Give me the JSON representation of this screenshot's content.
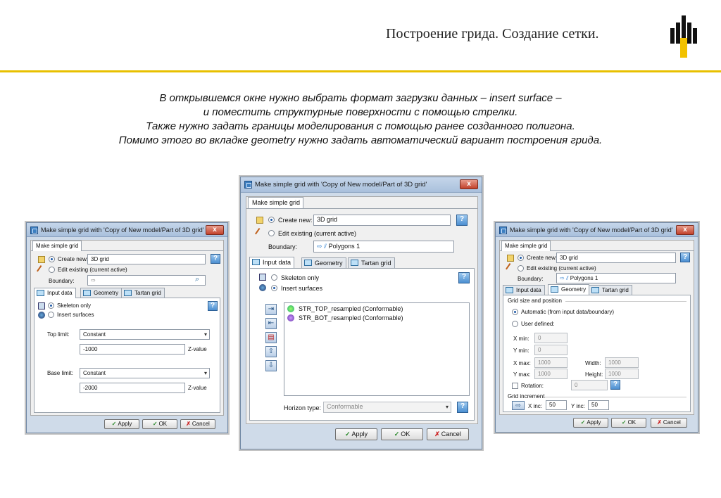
{
  "slide": {
    "title": "Построение грида. Создание сетки.",
    "intro": [
      "В открывшемся окне нужно выбрать формат загрузки данных – insert surface –",
      "и поместить структурные поверхности с помощью стрелки.",
      "Также нужно задать границы моделирования с помощью ранее созданного полигона.",
      "Помимо этого во вкладке geometry нужно задать автоматический вариант построения грида."
    ],
    "accent_color": "#e8c000"
  },
  "common": {
    "window_title": "Make simple grid with 'Copy of New model/Part of 3D grid'",
    "group_tab": "Make simple grid",
    "create_new_label": "Create new:",
    "create_new_value": "3D grid",
    "edit_existing_label": "Edit existing (current active)",
    "boundary_label": "Boundary:",
    "tabs": [
      "Input data",
      "Geometry",
      "Tartan grid"
    ],
    "apply": "Apply",
    "ok": "OK",
    "cancel": "Cancel",
    "help": "?"
  },
  "left": {
    "boundary_value": "",
    "skeleton_only": "Skeleton only",
    "insert_surfaces": "Insert surfaces",
    "top_limit_label": "Top limit:",
    "top_limit_value": "Constant",
    "top_value": "-1000",
    "top_unit": "Z-value",
    "base_limit_label": "Base limit:",
    "base_limit_value": "Constant",
    "base_value": "-2000",
    "base_unit": "Z-value"
  },
  "center": {
    "boundary_value": "Polygons 1",
    "skeleton_only": "Skeleton only",
    "insert_surfaces": "Insert surfaces",
    "surfaces": [
      "STR_TOP_resampled  (Conformable)",
      "STR_BOT_resampled  (Conformable)"
    ],
    "horizon_type_label": "Horizon type:",
    "horizon_type_value": "Conformable"
  },
  "right": {
    "boundary_value": "Polygons 1",
    "section_size": "Grid size and position",
    "automatic": "Automatic (from input data/boundary)",
    "user_defined": "User defined:",
    "xmin_label": "X min:",
    "xmin": "0",
    "ymin_label": "Y min:",
    "ymin": "0",
    "xmax_label": "X max:",
    "xmax": "1000",
    "ymax_label": "Y max:",
    "ymax": "1000",
    "width_label": "Width:",
    "width": "1000",
    "height_label": "Height:",
    "height": "1000",
    "rotation_label": "Rotation:",
    "rotation": "0",
    "section_inc": "Grid increment",
    "xinc_label": "X inc:",
    "xinc": "50",
    "yinc_label": "Y inc:",
    "yinc": "50"
  }
}
